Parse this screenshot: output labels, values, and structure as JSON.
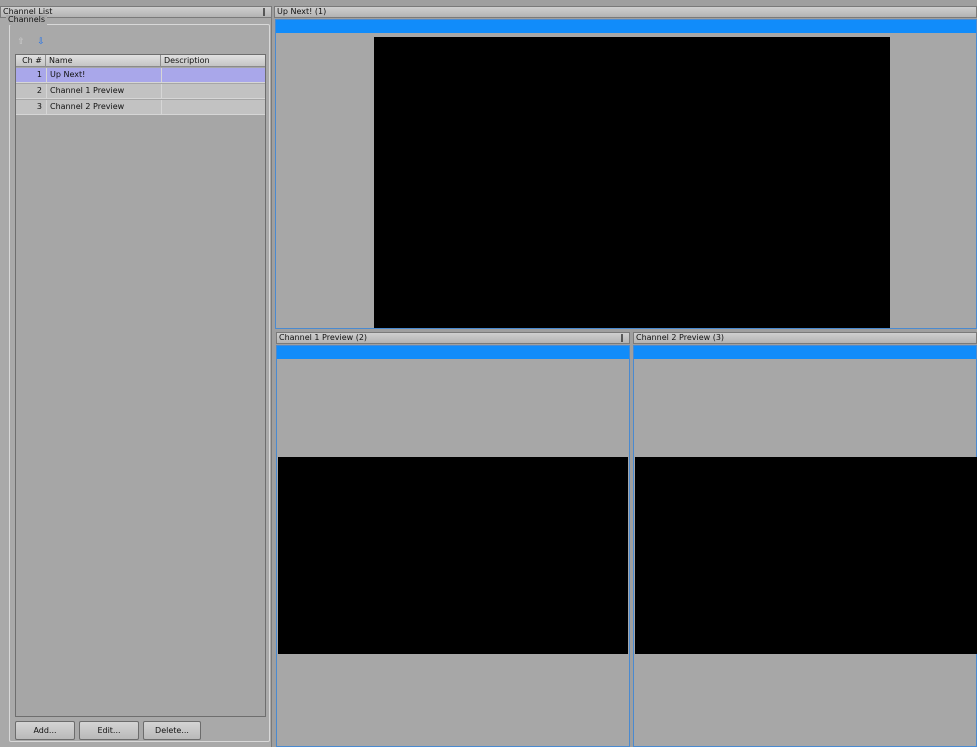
{
  "channel_list_panel": {
    "title": "Channel List",
    "group_label": "Channels",
    "columns": [
      "Ch #",
      "Name",
      "Description"
    ],
    "rows": [
      {
        "num": "1",
        "name": "Up Next!",
        "description": "",
        "selected": true
      },
      {
        "num": "2",
        "name": "Channel 1 Preview",
        "description": ""
      },
      {
        "num": "3",
        "name": "Channel 2 Preview",
        "description": ""
      }
    ],
    "buttons": {
      "add": "Add...",
      "edit": "Edit...",
      "delete": "Delete..."
    }
  },
  "previews": {
    "main": {
      "title": "Up Next! (1)"
    },
    "left": {
      "title": "Channel 1 Preview (2)"
    },
    "right": {
      "title": "Channel 2 Preview (3)"
    }
  },
  "icons": {
    "pin": "pin-icon",
    "move_up": "arrow-up-icon",
    "move_down": "arrow-down-icon"
  },
  "colors": {
    "accent_bar": "#118cfa",
    "selected_row": "#a9a7ea",
    "video_bg": "#000000"
  }
}
